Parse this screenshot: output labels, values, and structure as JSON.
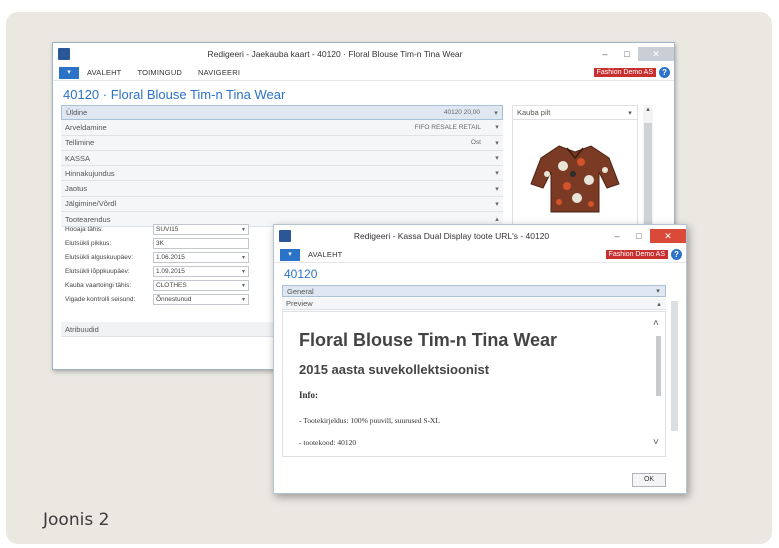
{
  "caption": "Joonis 2",
  "main": {
    "title": "Redigeeri - Jaekauba kaart - 40120 · Floral Blouse Tim-n Tina Wear",
    "menu": [
      "AVALEHT",
      "TOIMINGUD",
      "NAVIGEERI"
    ],
    "company": "Fashion Demo AS",
    "page_title": "40120 · Floral Blouse Tim-n Tina Wear",
    "fasttabs": [
      {
        "label": "Üldine",
        "summary": "40120  20,00"
      },
      {
        "label": "Arveldamine",
        "summary": "FIFO  RESALE  RETAIL"
      },
      {
        "label": "Tellimine",
        "summary": "Ost"
      },
      {
        "label": "KASSA",
        "summary": ""
      },
      {
        "label": "Hinnakujundus",
        "summary": ""
      },
      {
        "label": "Jaotus",
        "summary": ""
      },
      {
        "label": "Jälgimine/Võrdl",
        "summary": ""
      },
      {
        "label": "Tootearendus",
        "summary": ""
      }
    ],
    "fields": [
      {
        "label": "Hooaja tähis:",
        "value": "SUVI15"
      },
      {
        "label": "Elutsükli pikkus:",
        "value": "3K"
      },
      {
        "label": "Elutsükli alguskuupäev:",
        "value": "1.06.2015"
      },
      {
        "label": "Elutsükli lõppkuupäev:",
        "value": "1.09.2015"
      },
      {
        "label": "Kauba vaartoingi tähis:",
        "value": "CLOTHES"
      },
      {
        "label": "Vigade kontrolli seisund:",
        "value": "Õnnestunud"
      }
    ],
    "attributes": "Atribuudid",
    "factbox_title": "Kauba pilt"
  },
  "dialog": {
    "title": "Redigeeri - Kassa Dual Display toote URL's - 40120",
    "menu": "AVALEHT",
    "company": "Fashion Demo AS",
    "page_title": "40120",
    "general": "General",
    "preview_label": "Preview",
    "preview": {
      "h1": "Floral Blouse Tim-n Tina Wear",
      "h2": "2015 aasta suvekollektsioonist",
      "info": "Info:",
      "line1": "- Tootekirjeldus: 100% puuvill, suurused S-XL",
      "line2": "- tootekood: 40120"
    },
    "ok": "OK"
  }
}
